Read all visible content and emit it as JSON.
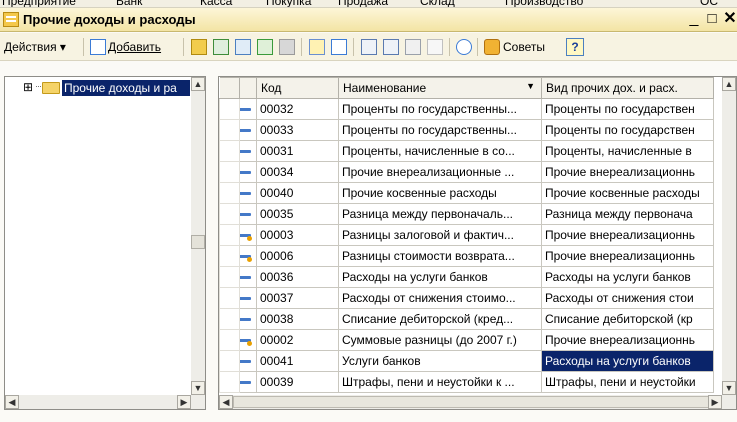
{
  "menubar": [
    "Предприятие",
    "Банк",
    "Касса",
    "Покупка",
    "Продажа",
    "Склад",
    "Производство",
    "ОС"
  ],
  "window": {
    "title": "Прочие доходы и расходы",
    "minimize": "_",
    "maximize": "□",
    "close": "✕"
  },
  "toolbar": {
    "actions_label": "Действия ▾",
    "add_label": "Добавить",
    "tips_label": "Советы",
    "help_label": "?"
  },
  "tree": {
    "root_label": "Прочие доходы и ра",
    "expander": "⊞"
  },
  "table": {
    "columns": [
      "Код",
      "Наименование",
      "Вид прочих дох. и расх."
    ],
    "sort_indicator": "▼",
    "rows": [
      {
        "code": "00032",
        "name": "Проценты по государственны...",
        "kind": "Проценты по государствен",
        "marked": false
      },
      {
        "code": "00033",
        "name": "Проценты по государственны...",
        "kind": "Проценты по государствен",
        "marked": false
      },
      {
        "code": "00031",
        "name": "Проценты, начисленные в со...",
        "kind": "Проценты, начисленные в",
        "marked": false
      },
      {
        "code": "00034",
        "name": "Прочие внереализационные ...",
        "kind": "Прочие внереализационнь",
        "marked": false
      },
      {
        "code": "00040",
        "name": "Прочие косвенные расходы",
        "kind": "Прочие косвенные расходы",
        "marked": false
      },
      {
        "code": "00035",
        "name": "Разница между первоначаль...",
        "kind": "Разница между первонача",
        "marked": false
      },
      {
        "code": "00003",
        "name": "Разницы залоговой и фактич...",
        "kind": "Прочие внереализационнь",
        "marked": true
      },
      {
        "code": "00006",
        "name": "Разницы стоимости возврата...",
        "kind": "Прочие внереализационнь",
        "marked": true
      },
      {
        "code": "00036",
        "name": "Расходы на услуги банков",
        "kind": "Расходы на услуги банков",
        "marked": false
      },
      {
        "code": "00037",
        "name": "Расходы от снижения стоимо...",
        "kind": "Расходы от снижения стои",
        "marked": false
      },
      {
        "code": "00038",
        "name": "Списание дебиторской (кред...",
        "kind": "Списание дебиторской (кр",
        "marked": false
      },
      {
        "code": "00002",
        "name": "Суммовые разницы (до 2007 г.)",
        "kind": "Прочие внереализационнь",
        "marked": true
      },
      {
        "code": "00041",
        "name": "Услуги банков",
        "kind": "Расходы на услуги банков",
        "marked": false,
        "selected": true
      },
      {
        "code": "00039",
        "name": "Штрафы, пени и неустойки к ...",
        "kind": "Штрафы, пени и неустойки",
        "marked": false
      }
    ]
  }
}
